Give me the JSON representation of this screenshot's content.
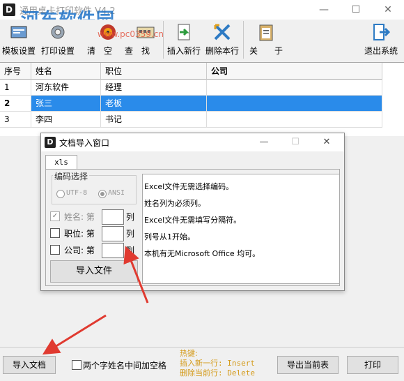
{
  "window": {
    "title": "通用桌卡打印软件 V4.2",
    "watermark": "河东软件园",
    "watermark_url": "www.pc0359.cn",
    "min": "—",
    "max": "☐",
    "close": "✕"
  },
  "toolbar": {
    "template_settings": "模板设置",
    "print_settings": "打印设置",
    "clear": "清",
    "empty": "空",
    "find": "查",
    "find2": "找",
    "insert_row": "插入新行",
    "delete_row": "删除本行",
    "about": "关　　于",
    "exit": "退出系统"
  },
  "grid": {
    "headers": [
      "序号",
      "姓名",
      "职位",
      "公司"
    ],
    "rows": [
      [
        "1",
        "河东软件",
        "经理",
        ""
      ],
      [
        "2",
        "张三",
        "老板",
        ""
      ],
      [
        "3",
        "李四",
        "书记",
        ""
      ]
    ]
  },
  "dialog": {
    "title": "文档导入窗口",
    "min": "—",
    "max": "☐",
    "close": "✕",
    "tab": "xls",
    "encoding_label": "编码选择",
    "enc_utf8": "UTF-8",
    "enc_ansi": "ANSI",
    "name_label": "姓名: 第",
    "position_label": "职位: 第",
    "company_label": "公司: 第",
    "col": "列",
    "import_file": "导入文件",
    "notes": [
      "Excel文件无需选择编码。",
      "姓名列为必须列。",
      "Excel文件无需填写分隔符。",
      "列号从1开始。",
      "本机有无Microsoft Office 均可。"
    ]
  },
  "bottom": {
    "import_doc": "导入文档",
    "space_option": "两个字姓名中间加空格",
    "hotkey_title": "热键:",
    "hotkey_insert": "插入新一行: Insert",
    "hotkey_delete": "删除当前行: Delete",
    "export_current": "导出当前表",
    "print": "打印"
  },
  "colors": {
    "selection": "#2a8bea",
    "arrow": "#e03a30",
    "hotkey": "#d49b1b"
  }
}
